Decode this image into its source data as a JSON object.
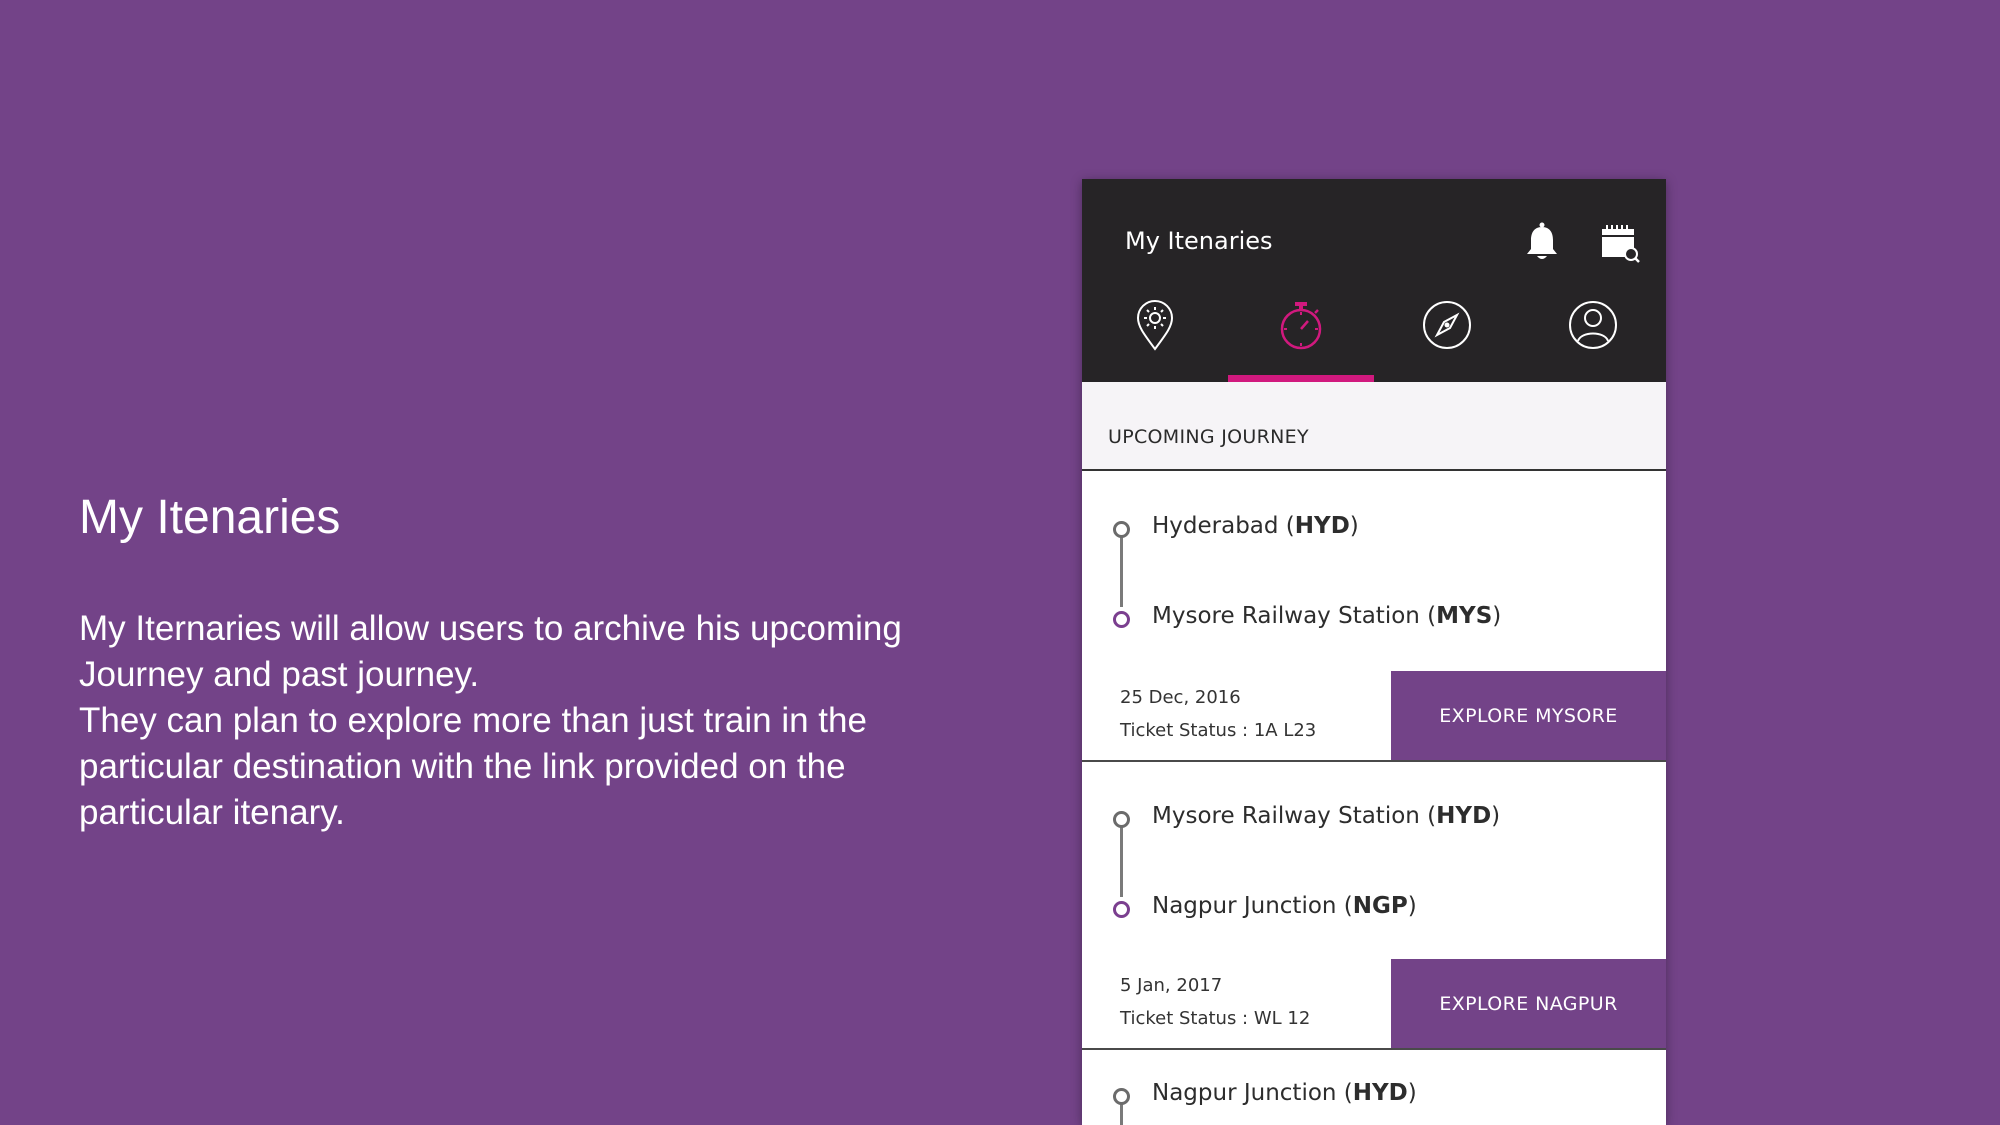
{
  "description": {
    "title": "My Itenaries",
    "paragraph1": "My Iternaries will allow users to archive his upcoming Journey and past journey.",
    "paragraph2": "They can plan to explore more than just train in the particular destination with the link provided on the particular itenary."
  },
  "app": {
    "title": "My Itenaries",
    "icons": {
      "notifications": "bell-icon",
      "calendar": "calendar-search-icon"
    },
    "tabs": [
      {
        "icon": "location-pin-icon",
        "active": false
      },
      {
        "icon": "stopwatch-icon",
        "active": true
      },
      {
        "icon": "compass-icon",
        "active": false
      },
      {
        "icon": "profile-icon",
        "active": false
      }
    ],
    "section_header": "UPCOMING JOURNEY",
    "journeys": [
      {
        "from": {
          "name": "Hyderabad",
          "code": "HYD"
        },
        "to": {
          "name": "Mysore Railway Station",
          "code": "MYS"
        },
        "date": "25 Dec, 2016",
        "ticket_status": "Ticket Status : 1A L23",
        "explore_label": "EXPLORE MYSORE"
      },
      {
        "from": {
          "name": "Mysore Railway Station",
          "code": "HYD"
        },
        "to": {
          "name": "Nagpur Junction",
          "code": "NGP"
        },
        "date": "5 Jan, 2017",
        "ticket_status": "Ticket Status : WL 12",
        "explore_label": "EXPLORE NAGPUR"
      },
      {
        "from": {
          "name": "Nagpur Junction",
          "code": "HYD"
        }
      }
    ]
  },
  "colors": {
    "background": "#734388",
    "app_bar": "#262426",
    "active_tab_accent": "#d1197e",
    "explore_button": "#734388"
  }
}
